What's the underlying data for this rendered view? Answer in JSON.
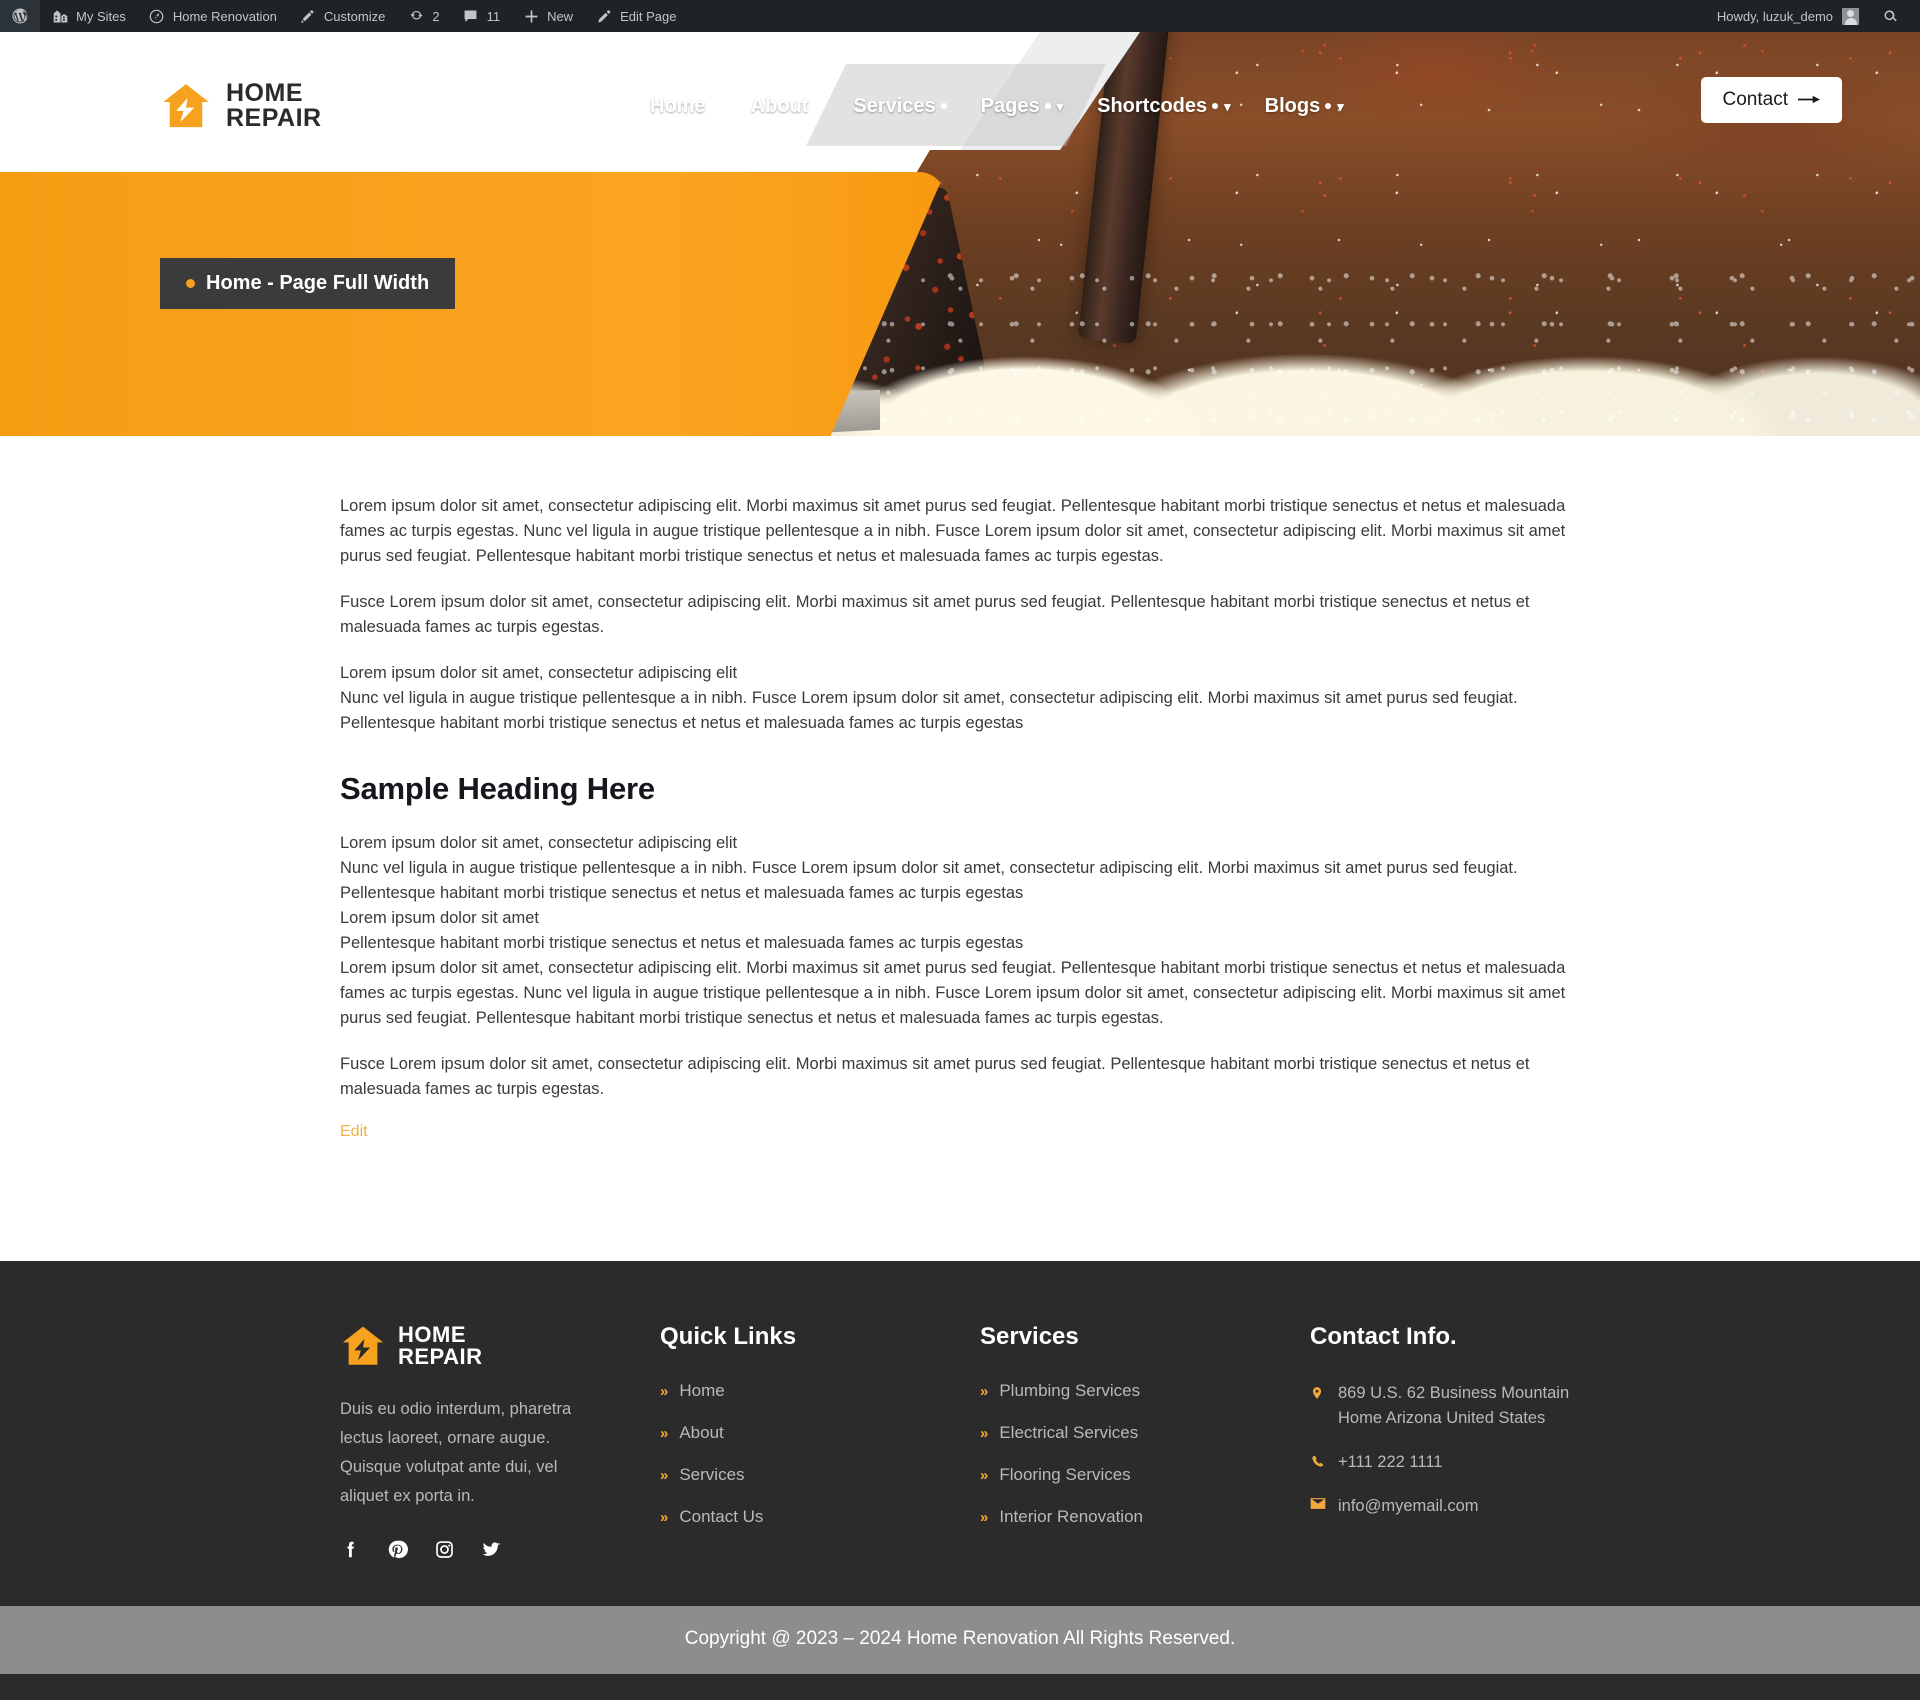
{
  "adminbar": {
    "left_items": [
      {
        "icon": "wordpress-icon",
        "label": ""
      },
      {
        "icon": "sites-icon",
        "label": "My Sites"
      },
      {
        "icon": "dashboard-icon",
        "label": "Home Renovation"
      },
      {
        "icon": "brush-icon",
        "label": "Customize"
      },
      {
        "icon": "revision-icon",
        "label": "2"
      },
      {
        "icon": "comment-icon",
        "label": "11"
      },
      {
        "icon": "plus-icon",
        "label": "New"
      },
      {
        "icon": "pencil-icon",
        "label": "Edit Page"
      }
    ],
    "howdy": "Howdy, luzuk_demo",
    "search_icon": "search-icon"
  },
  "header": {
    "logo": {
      "line1": "HOME",
      "line2": "REPAIR",
      "icon": "house-repair-logo-icon"
    },
    "nav": [
      {
        "label": "Home",
        "has_dot": true,
        "has_chevron": false
      },
      {
        "label": "About",
        "has_dot": true,
        "has_chevron": false
      },
      {
        "label": "Services",
        "has_dot": true,
        "has_chevron": false
      },
      {
        "label": "Pages",
        "has_dot": true,
        "has_chevron": true
      },
      {
        "label": "Shortcodes",
        "has_dot": true,
        "has_chevron": true
      },
      {
        "label": "Blogs",
        "has_dot": true,
        "has_chevron": true
      }
    ],
    "contact_button": "Contact",
    "contact_arrow": "arrow-right-icon"
  },
  "hero": {
    "breadcrumb": "Home - Page Full Width",
    "panel_color": "#f79d14",
    "breadcrumb_bg": "#3b3b3b",
    "accent": "#f6a21e"
  },
  "main": {
    "paragraphs": [
      "Lorem ipsum dolor sit amet, consectetur adipiscing elit. Morbi maximus sit amet purus sed feugiat. Pellentesque habitant morbi tristique senectus et netus et malesuada fames ac turpis egestas. Nunc vel ligula in augue tristique pellentesque a in nibh. Fusce Lorem ipsum dolor sit amet, consectetur adipiscing elit. Morbi maximus sit amet purus sed feugiat. Pellentesque habitant morbi tristique senectus et netus et malesuada fames ac turpis egestas.",
      "Fusce Lorem ipsum dolor sit amet, consectetur adipiscing elit. Morbi maximus sit amet purus sed feugiat. Pellentesque habitant morbi tristique senectus et netus et malesuada fames ac turpis egestas.",
      "Lorem ipsum dolor sit amet, consectetur adipiscing elit\nNunc vel ligula in augue tristique pellentesque a in nibh. Fusce Lorem ipsum dolor sit amet, consectetur adipiscing elit. Morbi maximus sit amet purus sed feugiat. Pellentesque habitant morbi tristique senectus et netus et malesuada fames ac turpis egestas"
    ],
    "heading": "Sample Heading Here",
    "paragraphs_after": [
      "Lorem ipsum dolor sit amet, consectetur adipiscing elit\nNunc vel ligula in augue tristique pellentesque a in nibh. Fusce Lorem ipsum dolor sit amet, consectetur adipiscing elit. Morbi maximus sit amet purus sed feugiat. Pellentesque habitant morbi tristique senectus et netus et malesuada fames ac turpis egestas\nLorem ipsum dolor sit amet\nPellentesque habitant morbi tristique senectus et netus et malesuada fames ac turpis egestas\nLorem ipsum dolor sit amet, consectetur adipiscing elit. Morbi maximus sit amet purus sed feugiat. Pellentesque habitant morbi tristique senectus et netus et malesuada fames ac turpis egestas. Nunc vel ligula in augue tristique pellentesque a in nibh. Fusce Lorem ipsum dolor sit amet, consectetur adipiscing elit. Morbi maximus sit amet purus sed feugiat. Pellentesque habitant morbi tristique senectus et netus et malesuada fames ac turpis egestas.",
      "Fusce Lorem ipsum dolor sit amet, consectetur adipiscing elit. Morbi maximus sit amet purus sed feugiat. Pellentesque habitant morbi tristique senectus et netus et malesuada fames ac turpis egestas."
    ],
    "edit_link": "Edit"
  },
  "footer": {
    "logo": {
      "line1": "HOME",
      "line2": "REPAIR",
      "icon": "house-repair-logo-icon"
    },
    "description": "Duis eu odio interdum, pharetra lectus laoreet, ornare augue. Quisque volutpat ante dui, vel aliquet ex porta in.",
    "social": [
      {
        "name": "facebook-icon"
      },
      {
        "name": "pinterest-icon"
      },
      {
        "name": "instagram-icon"
      },
      {
        "name": "twitter-icon"
      }
    ],
    "quick_links": {
      "title": "Quick Links",
      "items": [
        "Home",
        "About",
        "Services",
        "Contact Us"
      ]
    },
    "services": {
      "title": "Services",
      "items": [
        "Plumbing Services",
        "Electrical Services",
        "Flooring Services",
        "Interior Renovation"
      ]
    },
    "contact": {
      "title": "Contact Info.",
      "address": "869 U.S. 62 Business Mountain Home Arizona United States",
      "phone": "+111 222 1111",
      "email": "info@myemail.com",
      "icons": {
        "address": "location-pin-icon",
        "phone": "phone-icon",
        "email": "envelope-icon"
      }
    },
    "copyright": "Copyright @ 2023 – 2024 Home Renovation All Rights Reserved.",
    "accent": "#f2a93b"
  }
}
